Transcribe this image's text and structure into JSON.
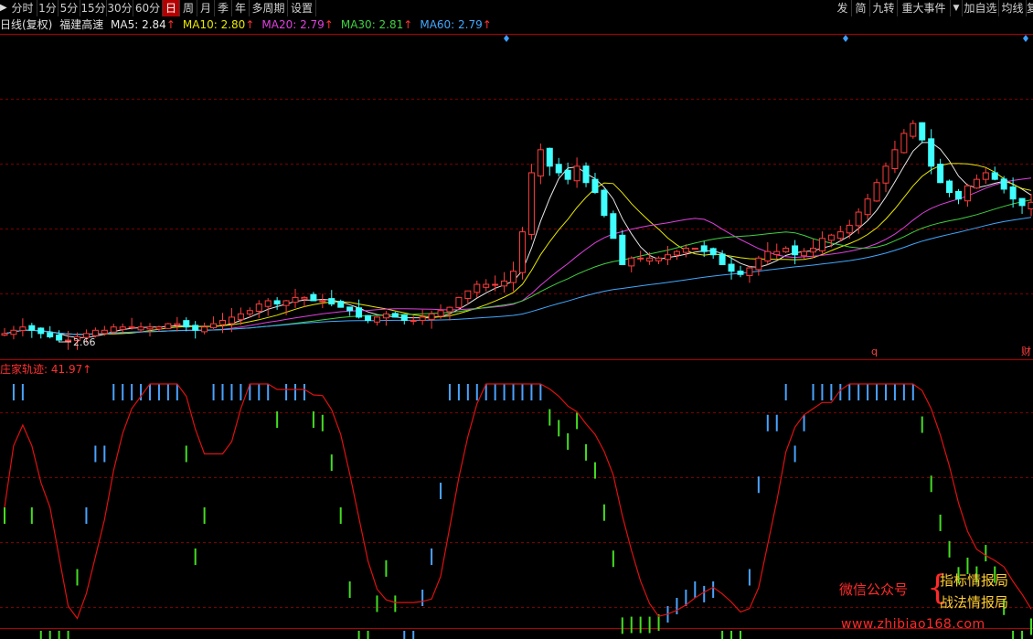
{
  "toolbar": {
    "left_items": [
      "分时",
      "1分",
      "5分",
      "15分",
      "30分",
      "60分",
      "日",
      "周",
      "月",
      "季",
      "年",
      "多周期",
      "设置"
    ],
    "active": "日",
    "right_items": [
      "发",
      "简",
      "九转",
      "重大事件",
      "▼",
      "加自选",
      "均线",
      "复"
    ]
  },
  "ma_legend": {
    "title": "日线(复权)",
    "stock": "福建高速",
    "items": [
      {
        "label": "MA5: 2.84",
        "color": "#e8e8e8"
      },
      {
        "label": "MA10: 2.80",
        "color": "#e8e800"
      },
      {
        "label": "MA20: 2.79",
        "color": "#e040e0"
      },
      {
        "label": "MA30: 2.81",
        "color": "#40d040"
      },
      {
        "label": "MA60: 2.79",
        "color": "#40a8ff"
      }
    ],
    "arrow": "↑"
  },
  "price_panel": {
    "low_label": "2.66",
    "marker_q": "q",
    "marker_cai": "财"
  },
  "indicator": {
    "title": "庄家轨迹: 41.97",
    "arrow": "↑"
  },
  "watermark": {
    "lead": "微信公众号",
    "line1": "指标情报局",
    "line2": "战法情报局",
    "url": "www.zhibiao168.com"
  },
  "colors": {
    "up": "#ff3c3c",
    "down": "#40ffff",
    "grid": "#7a0000",
    "bar_blue": "#4aa3ff",
    "bar_green": "#44dd22",
    "curve_red": "#e01010"
  },
  "chart_data": {
    "type": "candlestick",
    "price_series": [
      2.69,
      2.7,
      2.71,
      2.7,
      2.69,
      2.68,
      2.67,
      2.67,
      2.68,
      2.69,
      2.7,
      2.7,
      2.71,
      2.71,
      2.71,
      2.71,
      2.71,
      2.71,
      2.72,
      2.72,
      2.71,
      2.7,
      2.71,
      2.72,
      2.73,
      2.74,
      2.75,
      2.76,
      2.78,
      2.79,
      2.78,
      2.79,
      2.8,
      2.8,
      2.79,
      2.79,
      2.78,
      2.77,
      2.76,
      2.74,
      2.73,
      2.74,
      2.75,
      2.74,
      2.73,
      2.73,
      2.74,
      2.75,
      2.76,
      2.77,
      2.8,
      2.82,
      2.84,
      2.84,
      2.84,
      2.85,
      2.88,
      3.0,
      3.18,
      3.25,
      3.2,
      3.18,
      3.16,
      3.2,
      3.15,
      3.12,
      3.05,
      2.98,
      2.9,
      2.92,
      2.92,
      2.92,
      2.92,
      2.93,
      2.94,
      2.95,
      2.95,
      2.94,
      2.93,
      2.9,
      2.88,
      2.87,
      2.89,
      2.92,
      2.94,
      2.94,
      2.95,
      2.93,
      2.94,
      2.95,
      2.98,
      2.99,
      3.0,
      3.02,
      3.06,
      3.1,
      3.15,
      3.2,
      3.25,
      3.3,
      3.33,
      3.28,
      3.2,
      3.15,
      3.12,
      3.1,
      3.14,
      3.16,
      3.18,
      3.16,
      3.13,
      3.1,
      3.08,
      3.09
    ],
    "ma_lines": [
      "MA5",
      "MA10",
      "MA20",
      "MA30",
      "MA60"
    ],
    "indicator_name": "庄家轨迹",
    "indicator_value": 41.97
  }
}
